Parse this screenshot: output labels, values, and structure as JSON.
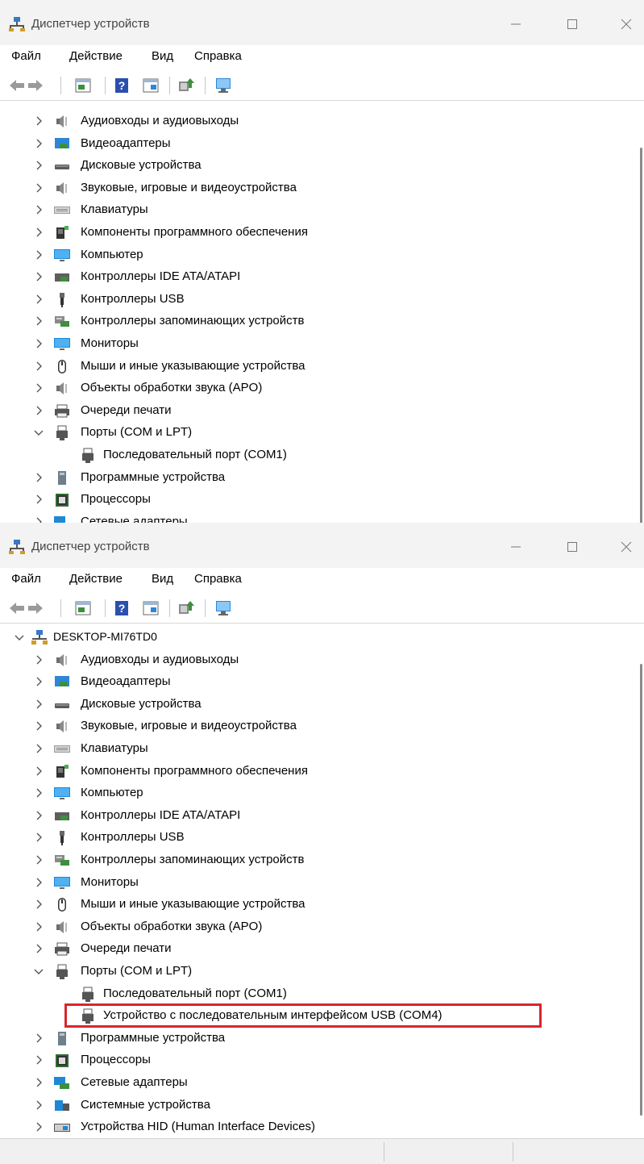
{
  "windows": [
    {
      "title": "Диспетчер устройств",
      "menu": [
        "Файл",
        "Действие",
        "Вид",
        "Справка"
      ],
      "tree": [
        {
          "label": "Аудиовходы и аудиовыходы",
          "icon": "speaker-icon",
          "level": 1,
          "state": "collapsed"
        },
        {
          "label": "Видеоадаптеры",
          "icon": "display-adapter-icon",
          "level": 1,
          "state": "collapsed"
        },
        {
          "label": "Дисковые устройства",
          "icon": "disk-drive-icon",
          "level": 1,
          "state": "collapsed"
        },
        {
          "label": "Звуковые, игровые и видеоустройства",
          "icon": "speaker-icon",
          "level": 1,
          "state": "collapsed"
        },
        {
          "label": "Клавиатуры",
          "icon": "keyboard-icon",
          "level": 1,
          "state": "collapsed"
        },
        {
          "label": "Компоненты программного обеспечения",
          "icon": "software-component-icon",
          "level": 1,
          "state": "collapsed"
        },
        {
          "label": "Компьютер",
          "icon": "monitor-icon",
          "level": 1,
          "state": "collapsed"
        },
        {
          "label": "Контроллеры IDE ATA/ATAPI",
          "icon": "ide-controller-icon",
          "level": 1,
          "state": "collapsed"
        },
        {
          "label": "Контроллеры USB",
          "icon": "usb-icon",
          "level": 1,
          "state": "collapsed"
        },
        {
          "label": "Контроллеры запоминающих устройств",
          "icon": "storage-controller-icon",
          "level": 1,
          "state": "collapsed"
        },
        {
          "label": "Мониторы",
          "icon": "monitor-icon",
          "level": 1,
          "state": "collapsed"
        },
        {
          "label": "Мыши и иные указывающие устройства",
          "icon": "mouse-icon",
          "level": 1,
          "state": "collapsed"
        },
        {
          "label": "Объекты обработки звука (APO)",
          "icon": "speaker-icon",
          "level": 1,
          "state": "collapsed"
        },
        {
          "label": "Очереди печати",
          "icon": "printer-icon",
          "level": 1,
          "state": "collapsed"
        },
        {
          "label": "Порты (COM и LPT)",
          "icon": "port-icon",
          "level": 1,
          "state": "expanded"
        },
        {
          "label": "Последовательный порт (COM1)",
          "icon": "port-icon",
          "level": 2,
          "state": "leaf"
        },
        {
          "label": "Программные устройства",
          "icon": "software-device-icon",
          "level": 1,
          "state": "collapsed"
        },
        {
          "label": "Процессоры",
          "icon": "processor-icon",
          "level": 1,
          "state": "collapsed"
        },
        {
          "label": "Сетевые адаптеры",
          "icon": "network-adapter-icon",
          "level": 1,
          "state": "collapsed"
        }
      ]
    },
    {
      "title": "Диспетчер устройств",
      "menu": [
        "Файл",
        "Действие",
        "Вид",
        "Справка"
      ],
      "tree": [
        {
          "label": "DESKTOP-MI76TD0",
          "icon": "computer-icon",
          "level": 0,
          "state": "expanded"
        },
        {
          "label": "Аудиовходы и аудиовыходы",
          "icon": "speaker-icon",
          "level": 1,
          "state": "collapsed"
        },
        {
          "label": "Видеоадаптеры",
          "icon": "display-adapter-icon",
          "level": 1,
          "state": "collapsed"
        },
        {
          "label": "Дисковые устройства",
          "icon": "disk-drive-icon",
          "level": 1,
          "state": "collapsed"
        },
        {
          "label": "Звуковые, игровые и видеоустройства",
          "icon": "speaker-icon",
          "level": 1,
          "state": "collapsed"
        },
        {
          "label": "Клавиатуры",
          "icon": "keyboard-icon",
          "level": 1,
          "state": "collapsed"
        },
        {
          "label": "Компоненты программного обеспечения",
          "icon": "software-component-icon",
          "level": 1,
          "state": "collapsed"
        },
        {
          "label": "Компьютер",
          "icon": "monitor-icon",
          "level": 1,
          "state": "collapsed"
        },
        {
          "label": "Контроллеры IDE ATA/ATAPI",
          "icon": "ide-controller-icon",
          "level": 1,
          "state": "collapsed"
        },
        {
          "label": "Контроллеры USB",
          "icon": "usb-icon",
          "level": 1,
          "state": "collapsed"
        },
        {
          "label": "Контроллеры запоминающих устройств",
          "icon": "storage-controller-icon",
          "level": 1,
          "state": "collapsed"
        },
        {
          "label": "Мониторы",
          "icon": "monitor-icon",
          "level": 1,
          "state": "collapsed"
        },
        {
          "label": "Мыши и иные указывающие устройства",
          "icon": "mouse-icon",
          "level": 1,
          "state": "collapsed"
        },
        {
          "label": "Объекты обработки звука (APO)",
          "icon": "speaker-icon",
          "level": 1,
          "state": "collapsed"
        },
        {
          "label": "Очереди печати",
          "icon": "printer-icon",
          "level": 1,
          "state": "collapsed"
        },
        {
          "label": "Порты (COM и LPT)",
          "icon": "port-icon",
          "level": 1,
          "state": "expanded"
        },
        {
          "label": "Последовательный порт (COM1)",
          "icon": "port-icon",
          "level": 2,
          "state": "leaf"
        },
        {
          "label": "Устройство с последовательным интерфейсом USB (COM4)",
          "icon": "port-icon",
          "level": 2,
          "state": "leaf",
          "highlighted": true
        },
        {
          "label": "Программные устройства",
          "icon": "software-device-icon",
          "level": 1,
          "state": "collapsed"
        },
        {
          "label": "Процессоры",
          "icon": "processor-icon",
          "level": 1,
          "state": "collapsed"
        },
        {
          "label": "Сетевые адаптеры",
          "icon": "network-adapter-icon",
          "level": 1,
          "state": "collapsed"
        },
        {
          "label": "Системные устройства",
          "icon": "system-device-icon",
          "level": 1,
          "state": "collapsed"
        },
        {
          "label": "Устройства HID (Human Interface Devices)",
          "icon": "hid-icon",
          "level": 1,
          "state": "collapsed"
        }
      ]
    }
  ],
  "colors": {
    "highlight_border": "#d7262e",
    "titlebar_bg": "#f3f3f3",
    "accent_blue": "#1e88d6"
  },
  "toolbar_icons": [
    "back-arrow-icon",
    "forward-arrow-icon",
    "properties-icon",
    "help-icon",
    "view-icon",
    "update-driver-icon",
    "scan-hardware-icon"
  ]
}
